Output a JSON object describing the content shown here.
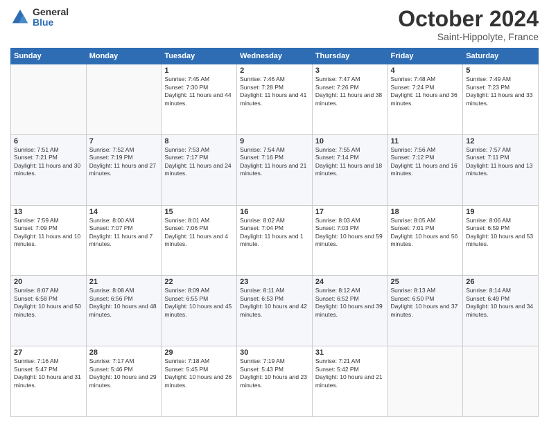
{
  "header": {
    "logo_general": "General",
    "logo_blue": "Blue",
    "title": "October 2024",
    "location": "Saint-Hippolyte, France"
  },
  "days_of_week": [
    "Sunday",
    "Monday",
    "Tuesday",
    "Wednesday",
    "Thursday",
    "Friday",
    "Saturday"
  ],
  "weeks": [
    [
      {
        "day": "",
        "sunrise": "",
        "sunset": "",
        "daylight": ""
      },
      {
        "day": "",
        "sunrise": "",
        "sunset": "",
        "daylight": ""
      },
      {
        "day": "1",
        "sunrise": "Sunrise: 7:45 AM",
        "sunset": "Sunset: 7:30 PM",
        "daylight": "Daylight: 11 hours and 44 minutes."
      },
      {
        "day": "2",
        "sunrise": "Sunrise: 7:46 AM",
        "sunset": "Sunset: 7:28 PM",
        "daylight": "Daylight: 11 hours and 41 minutes."
      },
      {
        "day": "3",
        "sunrise": "Sunrise: 7:47 AM",
        "sunset": "Sunset: 7:26 PM",
        "daylight": "Daylight: 11 hours and 38 minutes."
      },
      {
        "day": "4",
        "sunrise": "Sunrise: 7:48 AM",
        "sunset": "Sunset: 7:24 PM",
        "daylight": "Daylight: 11 hours and 36 minutes."
      },
      {
        "day": "5",
        "sunrise": "Sunrise: 7:49 AM",
        "sunset": "Sunset: 7:23 PM",
        "daylight": "Daylight: 11 hours and 33 minutes."
      }
    ],
    [
      {
        "day": "6",
        "sunrise": "Sunrise: 7:51 AM",
        "sunset": "Sunset: 7:21 PM",
        "daylight": "Daylight: 11 hours and 30 minutes."
      },
      {
        "day": "7",
        "sunrise": "Sunrise: 7:52 AM",
        "sunset": "Sunset: 7:19 PM",
        "daylight": "Daylight: 11 hours and 27 minutes."
      },
      {
        "day": "8",
        "sunrise": "Sunrise: 7:53 AM",
        "sunset": "Sunset: 7:17 PM",
        "daylight": "Daylight: 11 hours and 24 minutes."
      },
      {
        "day": "9",
        "sunrise": "Sunrise: 7:54 AM",
        "sunset": "Sunset: 7:16 PM",
        "daylight": "Daylight: 11 hours and 21 minutes."
      },
      {
        "day": "10",
        "sunrise": "Sunrise: 7:55 AM",
        "sunset": "Sunset: 7:14 PM",
        "daylight": "Daylight: 11 hours and 18 minutes."
      },
      {
        "day": "11",
        "sunrise": "Sunrise: 7:56 AM",
        "sunset": "Sunset: 7:12 PM",
        "daylight": "Daylight: 11 hours and 16 minutes."
      },
      {
        "day": "12",
        "sunrise": "Sunrise: 7:57 AM",
        "sunset": "Sunset: 7:11 PM",
        "daylight": "Daylight: 11 hours and 13 minutes."
      }
    ],
    [
      {
        "day": "13",
        "sunrise": "Sunrise: 7:59 AM",
        "sunset": "Sunset: 7:09 PM",
        "daylight": "Daylight: 11 hours and 10 minutes."
      },
      {
        "day": "14",
        "sunrise": "Sunrise: 8:00 AM",
        "sunset": "Sunset: 7:07 PM",
        "daylight": "Daylight: 11 hours and 7 minutes."
      },
      {
        "day": "15",
        "sunrise": "Sunrise: 8:01 AM",
        "sunset": "Sunset: 7:06 PM",
        "daylight": "Daylight: 11 hours and 4 minutes."
      },
      {
        "day": "16",
        "sunrise": "Sunrise: 8:02 AM",
        "sunset": "Sunset: 7:04 PM",
        "daylight": "Daylight: 11 hours and 1 minute."
      },
      {
        "day": "17",
        "sunrise": "Sunrise: 8:03 AM",
        "sunset": "Sunset: 7:03 PM",
        "daylight": "Daylight: 10 hours and 59 minutes."
      },
      {
        "day": "18",
        "sunrise": "Sunrise: 8:05 AM",
        "sunset": "Sunset: 7:01 PM",
        "daylight": "Daylight: 10 hours and 56 minutes."
      },
      {
        "day": "19",
        "sunrise": "Sunrise: 8:06 AM",
        "sunset": "Sunset: 6:59 PM",
        "daylight": "Daylight: 10 hours and 53 minutes."
      }
    ],
    [
      {
        "day": "20",
        "sunrise": "Sunrise: 8:07 AM",
        "sunset": "Sunset: 6:58 PM",
        "daylight": "Daylight: 10 hours and 50 minutes."
      },
      {
        "day": "21",
        "sunrise": "Sunrise: 8:08 AM",
        "sunset": "Sunset: 6:56 PM",
        "daylight": "Daylight: 10 hours and 48 minutes."
      },
      {
        "day": "22",
        "sunrise": "Sunrise: 8:09 AM",
        "sunset": "Sunset: 6:55 PM",
        "daylight": "Daylight: 10 hours and 45 minutes."
      },
      {
        "day": "23",
        "sunrise": "Sunrise: 8:11 AM",
        "sunset": "Sunset: 6:53 PM",
        "daylight": "Daylight: 10 hours and 42 minutes."
      },
      {
        "day": "24",
        "sunrise": "Sunrise: 8:12 AM",
        "sunset": "Sunset: 6:52 PM",
        "daylight": "Daylight: 10 hours and 39 minutes."
      },
      {
        "day": "25",
        "sunrise": "Sunrise: 8:13 AM",
        "sunset": "Sunset: 6:50 PM",
        "daylight": "Daylight: 10 hours and 37 minutes."
      },
      {
        "day": "26",
        "sunrise": "Sunrise: 8:14 AM",
        "sunset": "Sunset: 6:49 PM",
        "daylight": "Daylight: 10 hours and 34 minutes."
      }
    ],
    [
      {
        "day": "27",
        "sunrise": "Sunrise: 7:16 AM",
        "sunset": "Sunset: 5:47 PM",
        "daylight": "Daylight: 10 hours and 31 minutes."
      },
      {
        "day": "28",
        "sunrise": "Sunrise: 7:17 AM",
        "sunset": "Sunset: 5:46 PM",
        "daylight": "Daylight: 10 hours and 29 minutes."
      },
      {
        "day": "29",
        "sunrise": "Sunrise: 7:18 AM",
        "sunset": "Sunset: 5:45 PM",
        "daylight": "Daylight: 10 hours and 26 minutes."
      },
      {
        "day": "30",
        "sunrise": "Sunrise: 7:19 AM",
        "sunset": "Sunset: 5:43 PM",
        "daylight": "Daylight: 10 hours and 23 minutes."
      },
      {
        "day": "31",
        "sunrise": "Sunrise: 7:21 AM",
        "sunset": "Sunset: 5:42 PM",
        "daylight": "Daylight: 10 hours and 21 minutes."
      },
      {
        "day": "",
        "sunrise": "",
        "sunset": "",
        "daylight": ""
      },
      {
        "day": "",
        "sunrise": "",
        "sunset": "",
        "daylight": ""
      }
    ]
  ]
}
